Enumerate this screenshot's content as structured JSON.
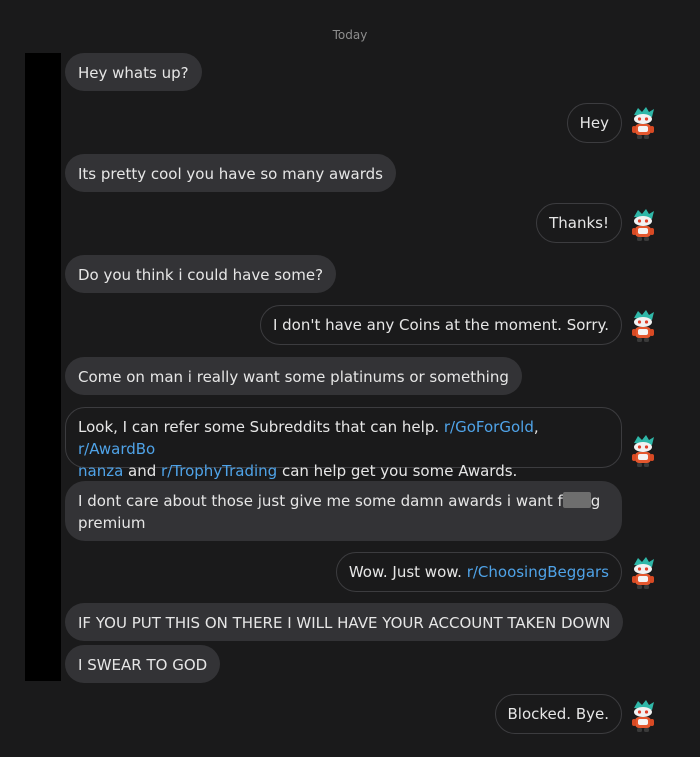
{
  "date_separator": "Today",
  "messages": {
    "m1": "Hey whats up?",
    "m2": "Hey",
    "m3": "Its pretty cool you have so many awards",
    "m4": "Thanks!",
    "m5": "Do you think i could have some?",
    "m6": "I don't have any Coins at the moment. Sorry.",
    "m7": "Come on man i really want some platinums or something",
    "m8": {
      "part1": "Look, I can refer some Subreddits that can help. ",
      "link1": "r/GoForGold",
      "sep1": ", ",
      "link2a": "r/AwardBo",
      "link2b": "nanza",
      "part2": " and ",
      "link3": "r/TrophyTrading",
      "part3": " can help get you some Awards."
    },
    "m9": {
      "part1": "I dont care about those just give me some damn awards i want f",
      "part2": "g",
      "part3": "premium"
    },
    "m10": {
      "part1": "Wow. Just wow. ",
      "link": "r/ChoosingBeggars"
    },
    "m11": "IF YOU PUT THIS ON THERE I WILL HAVE YOUR ACCOUNT TAKEN DOWN",
    "m12": "I SWEAR TO GOD",
    "m13": "Blocked. Bye."
  },
  "colors": {
    "background": "#1a1a1b",
    "incoming_bubble": "#333336",
    "outgoing_border": "#3c3c3f",
    "link": "#4fa3e8"
  },
  "icons": {
    "avatar": "snoo-avatar-icon"
  }
}
